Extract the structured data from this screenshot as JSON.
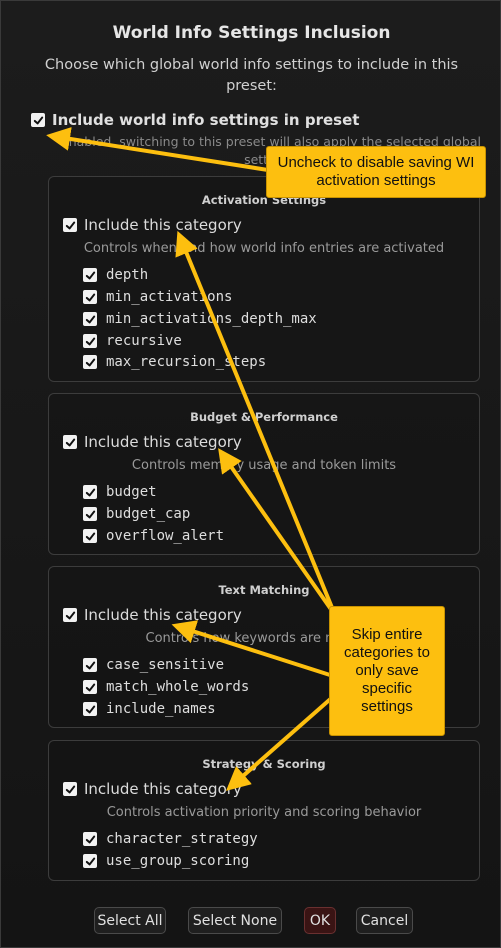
{
  "dialog": {
    "title": "World Info Settings Inclusion",
    "subtitle": "Choose which global world info settings to include in this preset:",
    "master_label": "Include world info settings in preset",
    "master_desc": "enabled, switching to this preset will also apply the selected global settings."
  },
  "categories": [
    {
      "title": "Activation Settings",
      "include_label": "Include this category",
      "description": "Controls when and how world info entries are activated",
      "settings": [
        "depth",
        "min_activations",
        "min_activations_depth_max",
        "recursive",
        "max_recursion_steps"
      ]
    },
    {
      "title": "Budget & Performance",
      "include_label": "Include this category",
      "description": "Controls memory usage and token limits",
      "settings": [
        "budget",
        "budget_cap",
        "overflow_alert"
      ]
    },
    {
      "title": "Text Matching",
      "include_label": "Include this category",
      "description": "Controls how keywords are matched",
      "settings": [
        "case_sensitive",
        "match_whole_words",
        "include_names"
      ]
    },
    {
      "title": "Strategy & Scoring",
      "include_label": "Include this category",
      "description": "Controls activation priority and scoring behavior",
      "settings": [
        "character_strategy",
        "use_group_scoring"
      ]
    }
  ],
  "buttons": {
    "select_all": "Select All",
    "select_none": "Select None",
    "ok": "OK",
    "cancel": "Cancel"
  },
  "callouts": {
    "top": "Uncheck to disable saving WI activation settings",
    "bottom": "Skip entire categories to only save specific settings"
  },
  "colors": {
    "callout": "#fdbf0f",
    "background": "#151515",
    "ok_button": "#3a1414"
  }
}
